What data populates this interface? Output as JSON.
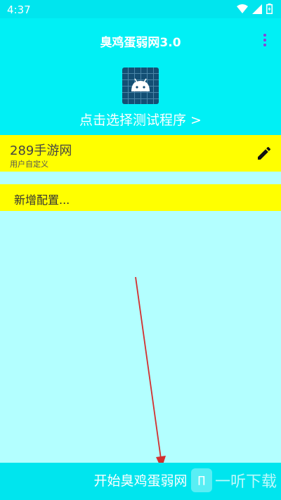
{
  "status_bar": {
    "time": "4:37"
  },
  "header": {
    "title": "臭鸡蛋弱网3.0",
    "choose_label": "点击选择测试程序 >"
  },
  "config_card": {
    "title": "289手游网",
    "subtitle": "用户自定义"
  },
  "add_config": {
    "label": "新增配置..."
  },
  "bottom": {
    "start_label": "开始臭鸡蛋弱网"
  },
  "watermark": {
    "text": "一听下载"
  },
  "colors": {
    "status_bar": "#00e5ee",
    "header": "#00f0f5",
    "body": "#b3ffff",
    "card": "#ffff00",
    "app_icon": "#134f74",
    "menu_dots": "#8b3fd9",
    "arrow": "#d32f2f"
  },
  "icons": [
    "wifi-icon",
    "signal-icon",
    "battery-icon",
    "more-vert-icon",
    "android-icon",
    "edit-pencil-icon",
    "watermark-logo-icon"
  ]
}
